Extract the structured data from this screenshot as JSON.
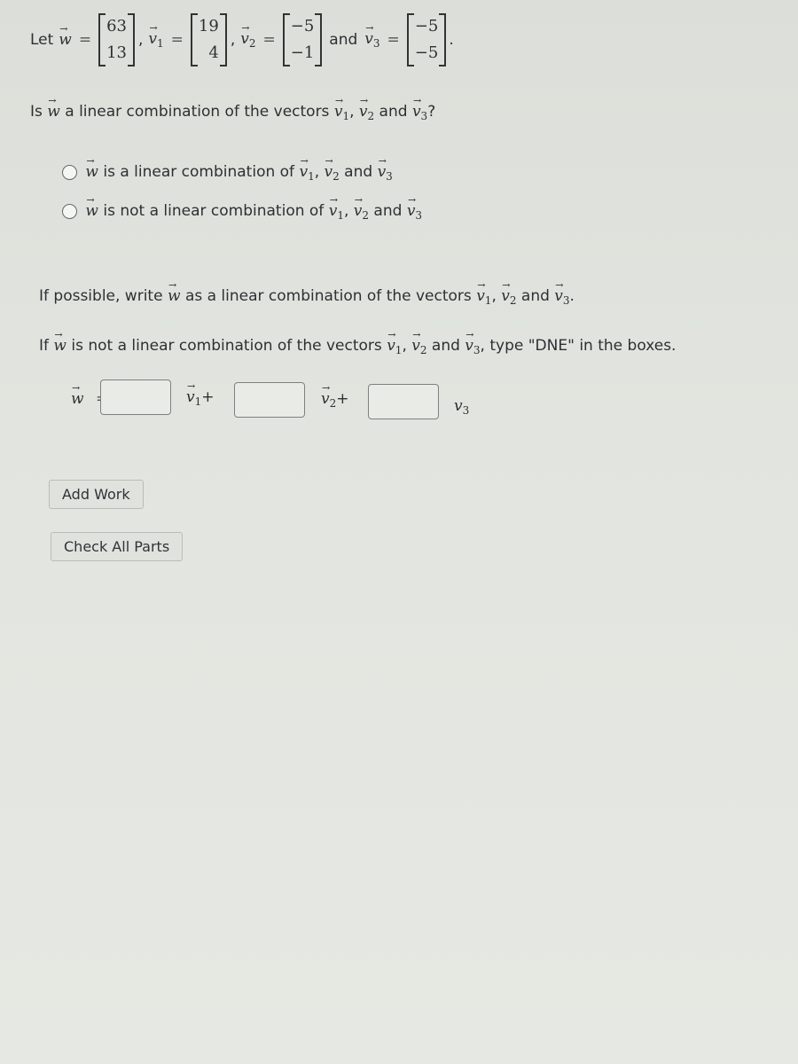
{
  "definition": {
    "let_label": "Let",
    "w": {
      "name": "w",
      "values": [
        "63",
        "13"
      ]
    },
    "v1": {
      "name": "v",
      "sub": "1",
      "values": [
        "19",
        "4"
      ]
    },
    "v2": {
      "name": "v",
      "sub": "2",
      "values": [
        "−5",
        "−1"
      ]
    },
    "v3": {
      "name": "v",
      "sub": "3",
      "values": [
        "−5",
        "−5"
      ]
    },
    "and_label": "and",
    "equals": "=",
    "comma": ",",
    "period": "."
  },
  "question": {
    "prefix": "Is",
    "text": "a linear combination of the vectors",
    "and": "and",
    "end": "?"
  },
  "options": [
    {
      "text": "is a linear combination of",
      "and": "and"
    },
    {
      "text": "is not a linear combination of",
      "and": "and"
    }
  ],
  "instructions": {
    "line1_prefix": "If possible, write",
    "line1_text": "as a linear combination of the vectors",
    "line1_and": "and",
    "line2_prefix": "If",
    "line2_text": "is not a linear combination of the vectors",
    "line2_and": "and",
    "line2_suffix": ", type \"DNE\" in the boxes."
  },
  "equation": {
    "lhs": "w",
    "equals": "=",
    "plus": "+",
    "coef1": "",
    "coef2": "",
    "coef3": "",
    "v3_label": "v"
  },
  "buttons": {
    "add_work": "Add Work",
    "check_all_parts": "Check All Parts"
  }
}
